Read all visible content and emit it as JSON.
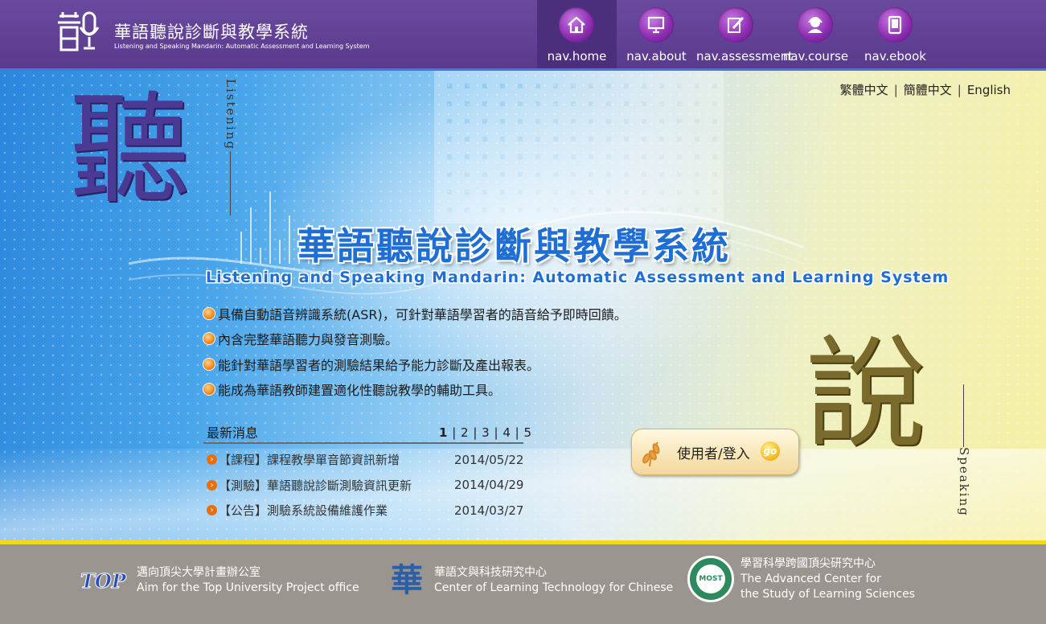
{
  "header": {
    "title_zh": "華語聽說診斷與教學系統",
    "title_en": "Listening and Speaking Mandarin: Automatic Assessment and Learning System",
    "logo_text": "音",
    "nav": [
      {
        "label": "nav.home",
        "icon": "home-icon",
        "active": true
      },
      {
        "label": "nav.about",
        "icon": "monitor-icon",
        "active": false
      },
      {
        "label": "nav.assessment",
        "icon": "edit-icon",
        "active": false
      },
      {
        "label": "nav.course",
        "icon": "user-headset-icon",
        "active": false
      },
      {
        "label": "nav.ebook",
        "icon": "tablet-icon",
        "active": false
      }
    ]
  },
  "languages": [
    "繁體中文",
    "簡體中文",
    "English"
  ],
  "banner": {
    "big_char_listen": "聽",
    "listen_label": "Listening",
    "big_char_speak": "說",
    "speak_label": "Speaking",
    "title_zh": "華語聽說診斷與教學系統",
    "title_en": "Listening and Speaking Mandarin: Automatic Assessment and Learning System",
    "features": [
      "具備自動語音辨識系統(ASR)，可針對華語學習者的語音給予即時回饋。",
      "內含完整華語聽力與發音測驗。",
      "能針對華語學習者的測驗結果給予能力診斷及產出報表。",
      "能成為華語教師建置適化性聽說教學的輔助工具。"
    ]
  },
  "news": {
    "heading": "最新消息",
    "pages": [
      "1",
      "2",
      "3",
      "4",
      "5"
    ],
    "current_page": "1",
    "items": [
      {
        "title": "【課程】課程教學單音節資訊新增",
        "date": "2014/05/22"
      },
      {
        "title": "【測驗】華語聽說診斷測驗資訊更新",
        "date": "2014/04/29"
      },
      {
        "title": "【公告】測驗系統設備維護作業",
        "date": "2014/03/27"
      }
    ]
  },
  "login": {
    "label": "使用者/登入",
    "go": "go"
  },
  "footer": {
    "partners": [
      {
        "logo": "TOP",
        "name_zh": "邁向頂尖大學計畫辦公室",
        "name_en": "Aim for the Top University Project office"
      },
      {
        "logo": "華",
        "name_zh": "華語文與科技研究中心",
        "name_en": "Center of Learning Technology for Chinese"
      },
      {
        "logo": "MOST",
        "name_zh": "學習科學跨國頂尖研究中心",
        "name_en_1": "The Advanced Center for",
        "name_en_2": "the Study of Learning Sciences"
      }
    ]
  },
  "colors": {
    "header": "#5a3a8c",
    "accent_blue": "#1e6ed3",
    "footer_yellow": "#f5d81a",
    "footer_bg": "#9b958f"
  }
}
